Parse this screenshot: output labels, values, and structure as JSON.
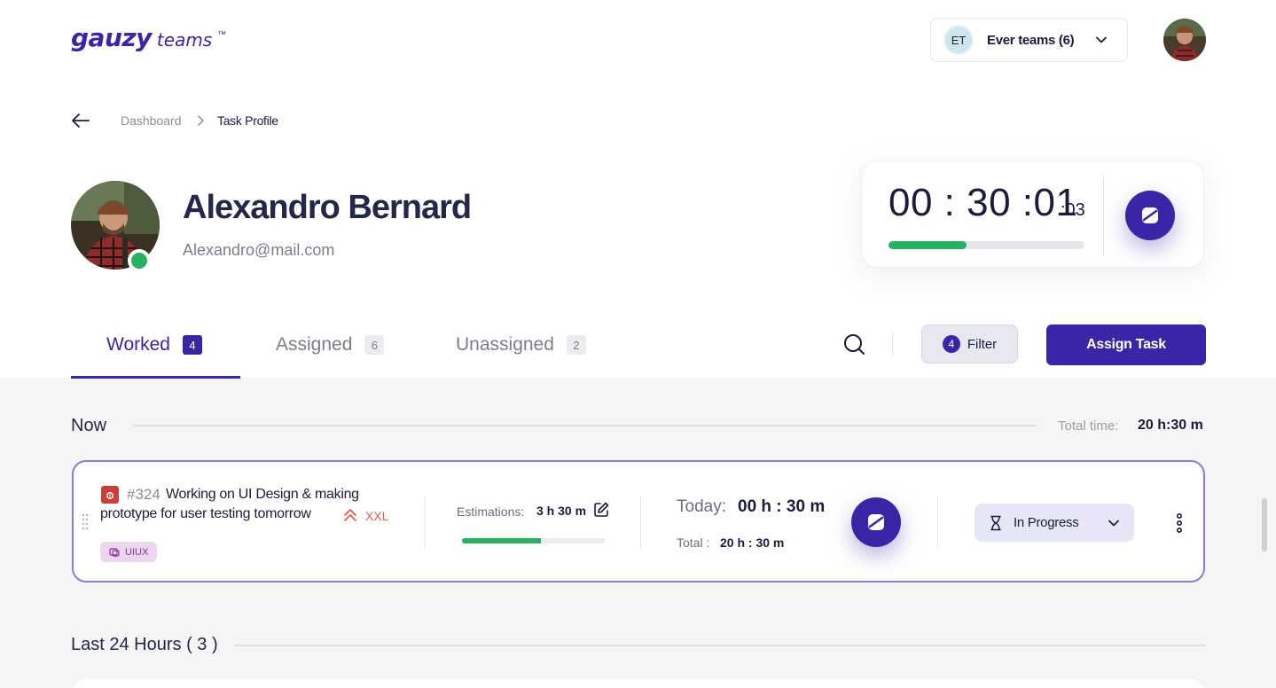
{
  "header": {
    "logo_main": "gauzy",
    "logo_sub": "teams",
    "logo_tm": "™",
    "team_initials": "ET",
    "team_name": "Ever teams (6)"
  },
  "breadcrumb": {
    "items": [
      "Dashboard",
      "Task Profile"
    ]
  },
  "profile": {
    "name": "Alexandro Bernard",
    "email": "Alexandro@mail.com",
    "status_color": "#27b261"
  },
  "timer": {
    "display": "00 : 30 :01",
    "ms": ":03",
    "progress": 0.4
  },
  "tabs": [
    {
      "label": "Worked",
      "count": "4"
    },
    {
      "label": "Assigned",
      "count": "6"
    },
    {
      "label": "Unassigned",
      "count": "2"
    }
  ],
  "toolbar": {
    "filter_count": "4",
    "filter_label": "Filter",
    "assign_label": "Assign Task"
  },
  "now_section": {
    "title": "Now",
    "total_label": "Total time:",
    "total_value": "20 h:30 m"
  },
  "task": {
    "number": "#324",
    "title_line1": "Working on UI Design & making",
    "title_line2": "prototype for user testing tomorrow",
    "size": "XXL",
    "tag": "UIUX",
    "estimation_label": "Estimations:",
    "estimation_value": "3 h 30 m",
    "estimation_progress": 0.55,
    "today_label": "Today:",
    "today_value": "00 h : 30 m",
    "total_label": "Total :",
    "total_value": "20 h : 30 m",
    "status": "In Progress"
  },
  "last24": {
    "title": "Last 24 Hours ( 3 )"
  },
  "colors": {
    "accent": "#3826a6",
    "success": "#27b261",
    "card_border": "#8c7ae0",
    "danger": "#e55a43"
  },
  "icons": [
    "back-arrow-icon",
    "chevron-right-icon",
    "chevron-down-icon",
    "search-icon",
    "play-icon",
    "bug-icon",
    "priority-up-icon",
    "edit-icon",
    "hourglass-icon",
    "kebab-menu-icon",
    "drag-handle-icon",
    "tag-icon"
  ]
}
